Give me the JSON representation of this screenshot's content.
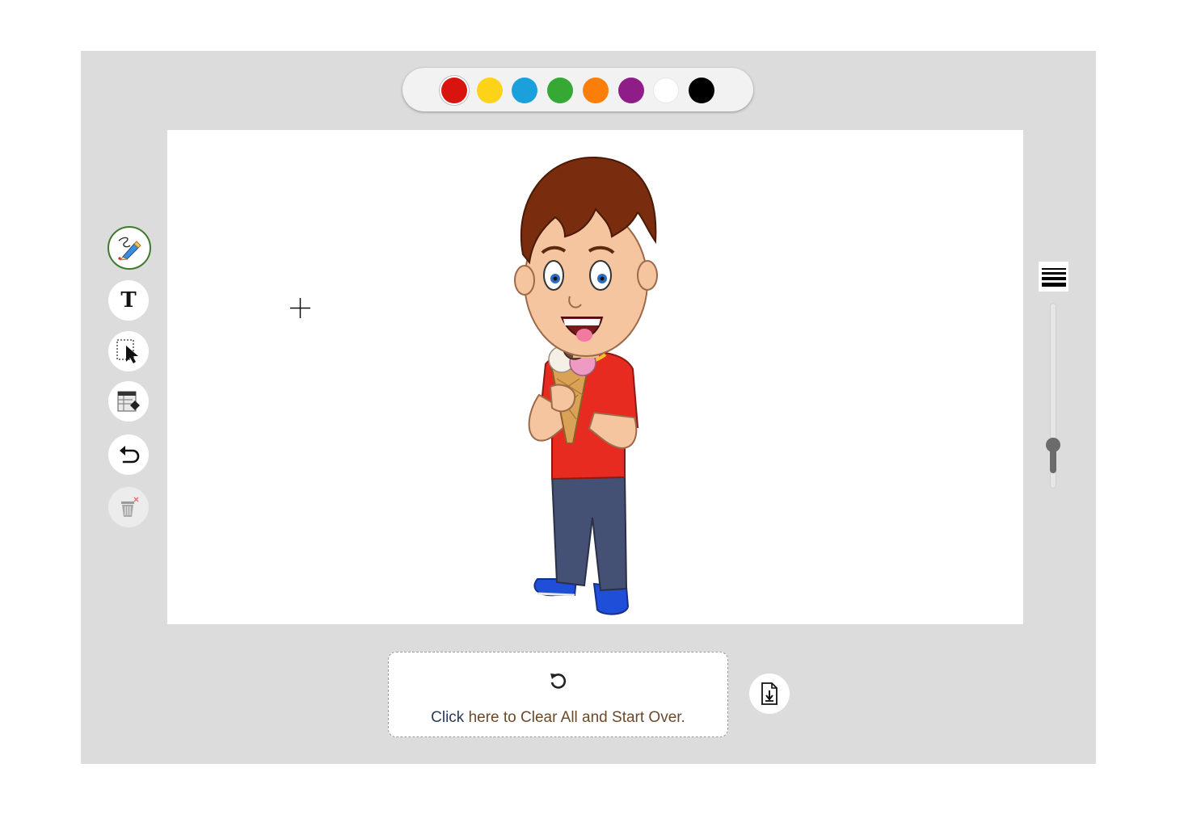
{
  "palette": {
    "colors": [
      "#d9140f",
      "#fdd319",
      "#1aa1dc",
      "#36a935",
      "#fb7e09",
      "#901d87",
      "#ffffff",
      "#000000"
    ],
    "selected_index": 0
  },
  "tools": [
    {
      "name": "pencil-tool",
      "icon": "pencil-icon",
      "active": true
    },
    {
      "name": "text-tool",
      "icon": "text-icon",
      "glyph": "T"
    },
    {
      "name": "select-tool",
      "icon": "select-pointer-icon"
    },
    {
      "name": "eraser-tool",
      "icon": "eraser-icon"
    },
    {
      "name": "undo-tool",
      "icon": "undo-icon"
    },
    {
      "name": "delete-tool",
      "icon": "trash-icon",
      "disabled": true
    }
  ],
  "brush_size": {
    "icon": "line-thickness-icon",
    "level": 0.1
  },
  "canvas": {
    "image": "cartoon boy eating ice cream"
  },
  "clear": {
    "icon": "reset-icon",
    "label": "Click here to Clear All and Start Over."
  },
  "download": {
    "icon": "download-file-icon"
  }
}
